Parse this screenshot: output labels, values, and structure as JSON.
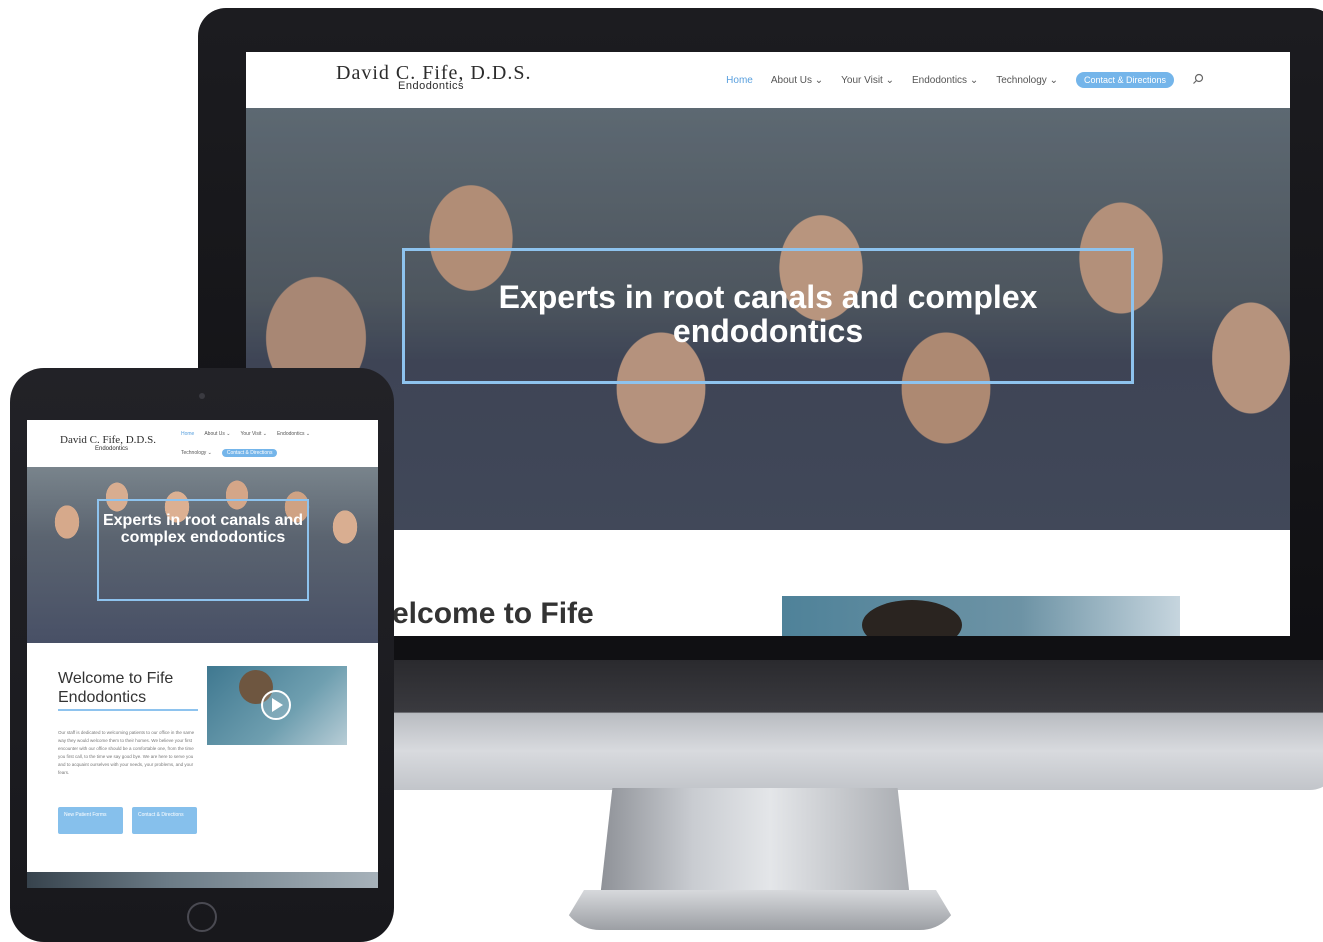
{
  "brand": {
    "logo_main": "David C. Fife, D.D.S.",
    "logo_sub": "Endodontics"
  },
  "desktop_nav": [
    {
      "label": "Home",
      "active": true
    },
    {
      "label": "About Us ⌄"
    },
    {
      "label": "Your Visit ⌄"
    },
    {
      "label": "Endodontics ⌄"
    },
    {
      "label": "Technology ⌄"
    },
    {
      "label": "Contact & Directions",
      "button": true
    }
  ],
  "tablet_nav_row1": [
    "Home",
    "About Us ⌄",
    "Your Visit ⌄",
    "Endodontics ⌄"
  ],
  "tablet_nav_row2": [
    "Technology ⌄",
    "Contact & Directions"
  ],
  "hero": {
    "title": "Experts in root canals and complex endodontics"
  },
  "desktop_welcome": "elcome to Fife",
  "tablet_welcome": "Welcome to Fife Endodontics",
  "tablet_body": "Our staff is dedicated to welcoming patients to our office in the same way they would welcome them to their homes. We believe your first encounter with our office should be a comfortable one, from the time you first call, to the time we say good bye. We are here to serve you and to acquaint ourselves with your needs, your problems, and your fears.",
  "tablet_buttons": {
    "new_patient": "New Patient Forms",
    "contact": "Contact & Directions"
  },
  "icons": {
    "search": "search-icon",
    "play": "play-icon"
  },
  "colors": {
    "accent": "#74b5ea",
    "hero_border": "#8ec3ee",
    "nav_active": "#5aa0de"
  }
}
